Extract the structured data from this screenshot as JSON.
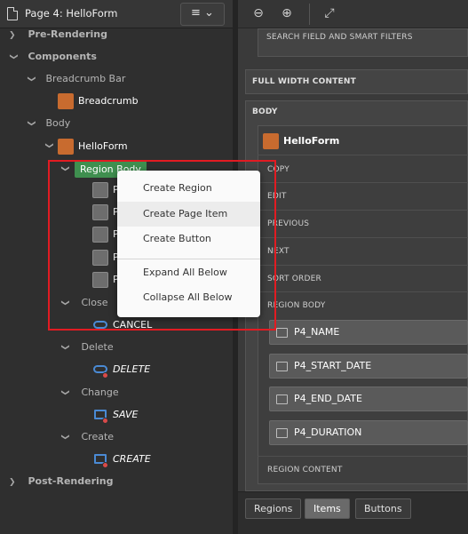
{
  "page_title": "Page 4: HelloForm",
  "menu_button": "≡ ⌄",
  "tree": {
    "pre_rendering": "Pre-Rendering",
    "components": "Components",
    "breadcrumb_bar": "Breadcrumb Bar",
    "breadcrumb": "Breadcrumb",
    "body": "Body",
    "helloform": "HelloForm",
    "region_body": "Region Body",
    "items": [
      "P",
      "P",
      "P",
      "P",
      "P"
    ],
    "close": "Close",
    "cancel": "CANCEL",
    "delete_group": "Delete",
    "delete": "DELETE",
    "change_group": "Change",
    "save": "SAVE",
    "create_group": "Create",
    "create": "CREATE",
    "post_rendering": "Post-Rendering"
  },
  "context_menu": {
    "items": [
      "Create Region",
      "Create Page Item",
      "Create Button"
    ],
    "items2": [
      "Expand All Below",
      "Collapse All Below"
    ]
  },
  "layout": {
    "search_filters": "SEARCH FIELD AND SMART FILTERS",
    "full_width": "FULL WIDTH CONTENT",
    "body": "BODY",
    "region_title": "HelloForm",
    "slots": [
      "COPY",
      "EDIT",
      "PREVIOUS",
      "NEXT",
      "SORT ORDER",
      "REGION BODY"
    ],
    "items": [
      "P4_NAME",
      "P4_START_DATE",
      "P4_END_DATE",
      "P4_DURATION"
    ],
    "region_content": "REGION CONTENT"
  },
  "bottom_tabs": [
    "Regions",
    "Items",
    "Buttons"
  ],
  "colors": {
    "highlight": "#e21b22",
    "region_body_tag": "#3f8f4f",
    "region_icon": "#c86b2f",
    "button_icon": "#4a8ad4"
  }
}
